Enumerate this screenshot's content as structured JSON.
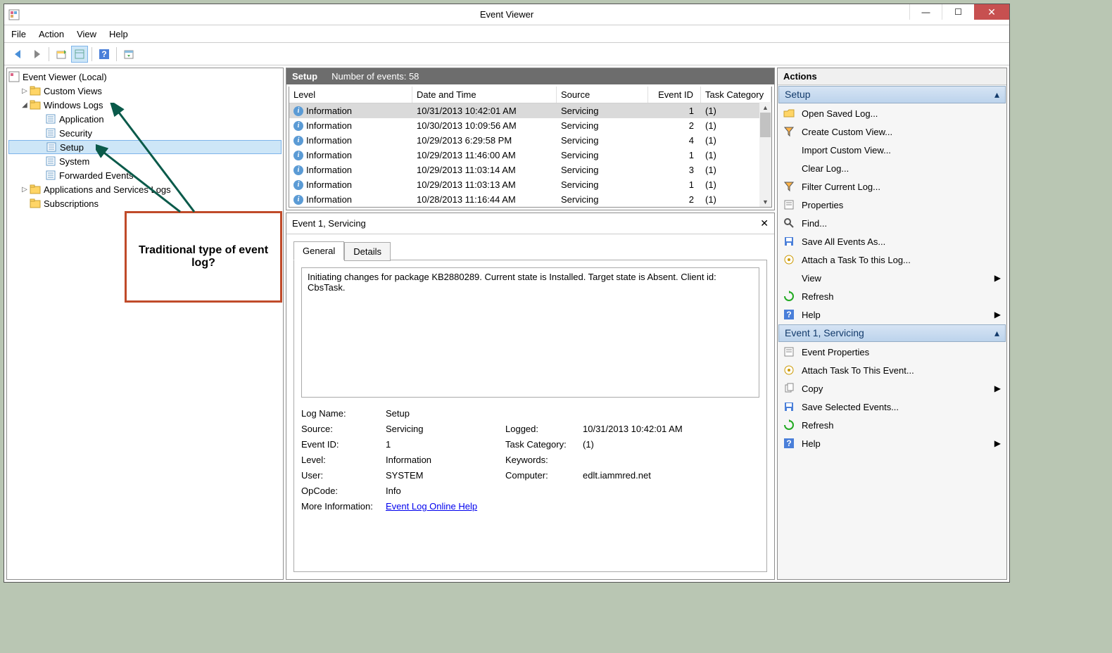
{
  "window": {
    "title": "Event Viewer"
  },
  "menu": [
    "File",
    "Action",
    "View",
    "Help"
  ],
  "tree": {
    "root": "Event Viewer (Local)",
    "items": [
      {
        "label": "Custom Views",
        "indent": 1,
        "toggle": "▷"
      },
      {
        "label": "Windows Logs",
        "indent": 1,
        "toggle": "◢"
      },
      {
        "label": "Application",
        "indent": 2
      },
      {
        "label": "Security",
        "indent": 2
      },
      {
        "label": "Setup",
        "indent": 2,
        "selected": true
      },
      {
        "label": "System",
        "indent": 2
      },
      {
        "label": "Forwarded Events",
        "indent": 2
      },
      {
        "label": "Applications and Services Logs",
        "indent": 1,
        "toggle": "▷"
      },
      {
        "label": "Subscriptions",
        "indent": 1
      }
    ]
  },
  "list": {
    "title": "Setup",
    "count_label": "Number of events: 58",
    "columns": [
      "Level",
      "Date and Time",
      "Source",
      "Event ID",
      "Task Category"
    ],
    "rows": [
      {
        "level": "Information",
        "date": "10/31/2013 10:42:01 AM",
        "source": "Servicing",
        "id": "1",
        "cat": "(1)",
        "selected": true
      },
      {
        "level": "Information",
        "date": "10/30/2013 10:09:56 AM",
        "source": "Servicing",
        "id": "2",
        "cat": "(1)"
      },
      {
        "level": "Information",
        "date": "10/29/2013 6:29:58 PM",
        "source": "Servicing",
        "id": "4",
        "cat": "(1)"
      },
      {
        "level": "Information",
        "date": "10/29/2013 11:46:00 AM",
        "source": "Servicing",
        "id": "1",
        "cat": "(1)"
      },
      {
        "level": "Information",
        "date": "10/29/2013 11:03:14 AM",
        "source": "Servicing",
        "id": "3",
        "cat": "(1)"
      },
      {
        "level": "Information",
        "date": "10/29/2013 11:03:13 AM",
        "source": "Servicing",
        "id": "1",
        "cat": "(1)"
      },
      {
        "level": "Information",
        "date": "10/28/2013 11:16:44 AM",
        "source": "Servicing",
        "id": "2",
        "cat": "(1)"
      }
    ]
  },
  "detail": {
    "header": "Event 1, Servicing",
    "tabs": [
      "General",
      "Details"
    ],
    "description": "Initiating changes for package KB2880289. Current state is Installed. Target state is Absent. Client id: CbsTask.",
    "props": {
      "log_name_l": "Log Name:",
      "log_name": "Setup",
      "source_l": "Source:",
      "source": "Servicing",
      "logged_l": "Logged:",
      "logged": "10/31/2013 10:42:01 AM",
      "eventid_l": "Event ID:",
      "eventid": "1",
      "taskcat_l": "Task Category:",
      "taskcat": "(1)",
      "level_l": "Level:",
      "level": "Information",
      "keywords_l": "Keywords:",
      "keywords": "",
      "user_l": "User:",
      "user": "SYSTEM",
      "computer_l": "Computer:",
      "computer": "edlt.iammred.net",
      "opcode_l": "OpCode:",
      "opcode": "Info",
      "moreinfo_l": "More Information:",
      "moreinfo_link": "Event Log Online Help"
    }
  },
  "actions": {
    "title": "Actions",
    "section1": "Setup",
    "items1": [
      "Open Saved Log...",
      "Create Custom View...",
      "Import Custom View...",
      "Clear Log...",
      "Filter Current Log...",
      "Properties",
      "Find...",
      "Save All Events As...",
      "Attach a Task To this Log..."
    ],
    "items1_sub": [
      "View"
    ],
    "items1_tail": [
      "Refresh",
      "Help"
    ],
    "section2": "Event 1, Servicing",
    "items2": [
      "Event Properties",
      "Attach Task To This Event...",
      "Copy",
      "Save Selected Events...",
      "Refresh",
      "Help"
    ]
  },
  "callout": "Traditional type of event log?"
}
